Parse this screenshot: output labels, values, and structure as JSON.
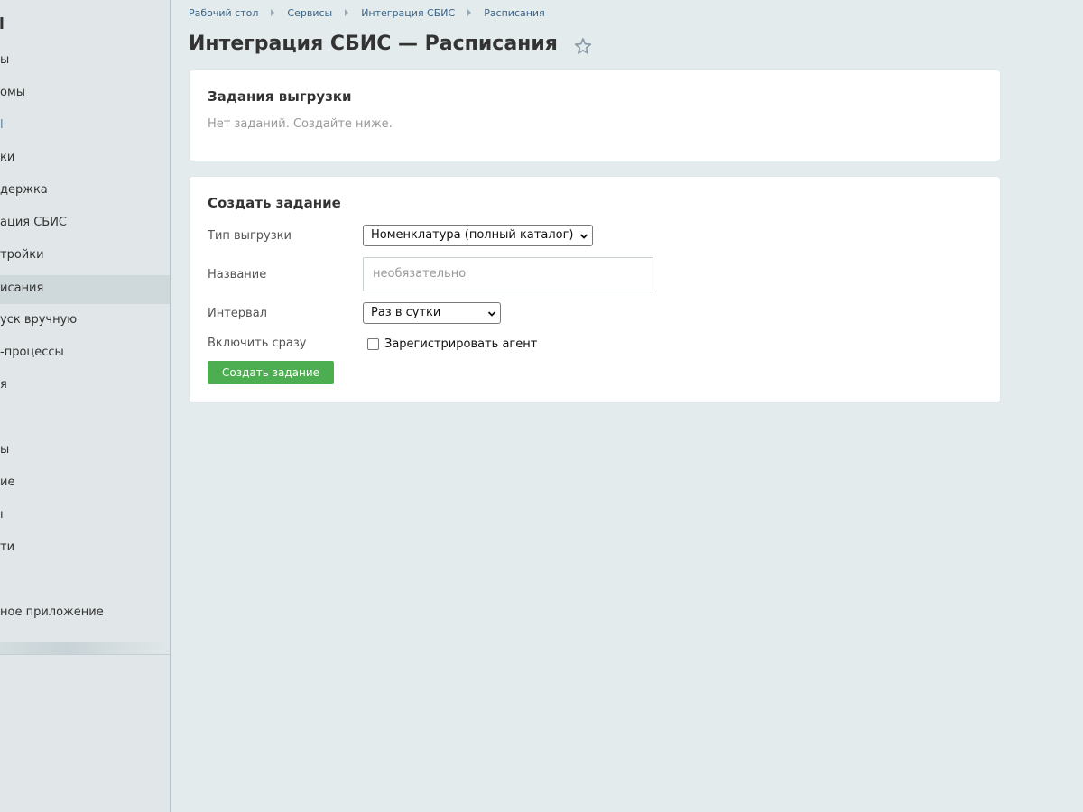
{
  "sidebar": {
    "title": "l",
    "items": [
      {
        "label": "ы"
      },
      {
        "label": "омы"
      },
      {
        "label": "l"
      },
      {
        "label": "ки"
      },
      {
        "label": "держка"
      },
      {
        "label": "ация СБИС"
      },
      {
        "label": "тройки"
      },
      {
        "label": "исания"
      },
      {
        "label": "уск вручную"
      },
      {
        "label": "-процессы"
      },
      {
        "label": "я"
      },
      {
        "label": "ы"
      },
      {
        "label": "ие"
      },
      {
        "label": "ı"
      },
      {
        "label": "ти"
      },
      {
        "label": "ное приложение"
      }
    ]
  },
  "breadcrumb": [
    "Рабочий стол",
    "Сервисы",
    "Интеграция СБИС",
    "Расписания"
  ],
  "page": {
    "title": "Интеграция СБИС — Расписания"
  },
  "jobs_card": {
    "title": "Задания выгрузки",
    "empty_text": "Нет заданий. Создайте ниже."
  },
  "create_card": {
    "title": "Создать задание",
    "type_label": "Тип выгрузки",
    "type_value": "Номенклатура (полный каталог)",
    "name_label": "Название",
    "name_placeholder": "необязательно",
    "interval_label": "Интервал",
    "interval_value": "Раз в сутки",
    "enable_label": "Включить сразу",
    "checkbox_label": "Зарегистрировать агент",
    "checkbox_checked": false,
    "submit_label": "Создать задание"
  },
  "colors": {
    "accent_button": "#4cae50",
    "link": "#3a6489"
  },
  "icons": {
    "favorite": "star-icon",
    "breadcrumb_sep": "chevron-right-icon",
    "select_arrow": "chevron-down-icon"
  }
}
